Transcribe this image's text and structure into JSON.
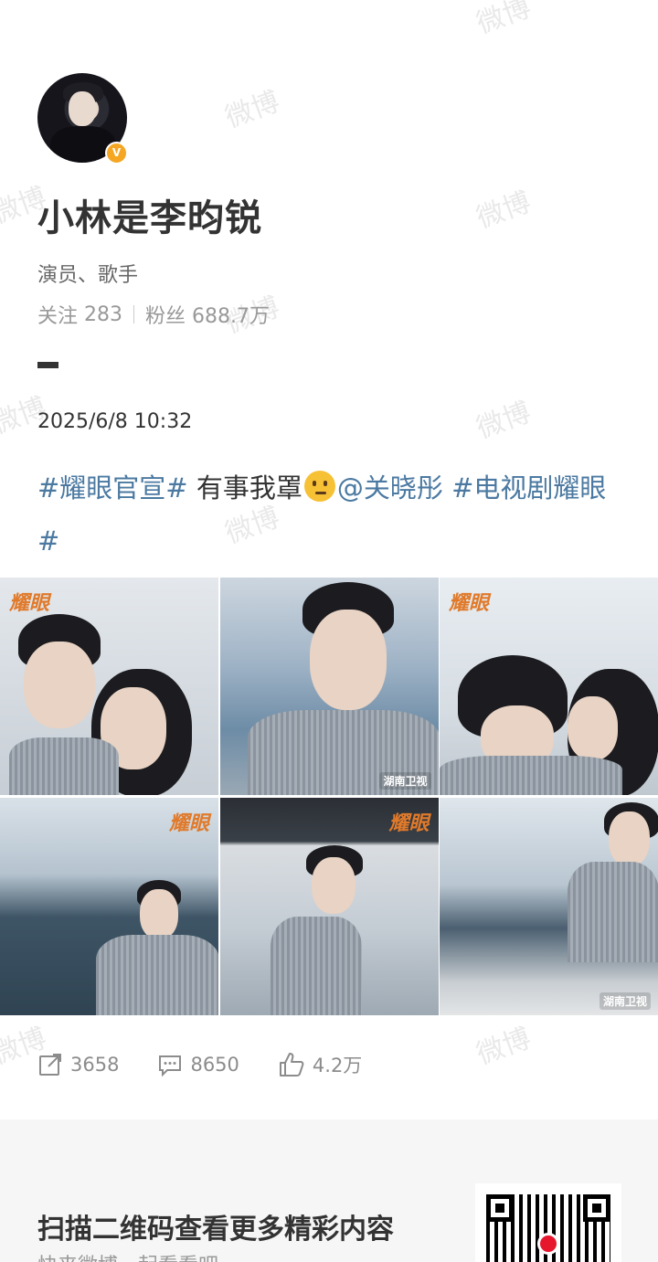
{
  "watermark_text": "微博",
  "profile": {
    "name": "小林是李昀锐",
    "verified_badge": "V",
    "bio": "演员、歌手",
    "following_label": "关注",
    "following_count": "283",
    "followers_label": "粉丝",
    "followers_count": "688.7万"
  },
  "post": {
    "date": "2025/6/8 10:32",
    "content": {
      "tag1": "#耀眼官宣#",
      "text": " 有事我罩",
      "emoji": "thinking-face-emoji",
      "mention": "@关晓彤",
      "tag2": "#电视剧耀眼#"
    },
    "images": [
      {
        "label": "image-1"
      },
      {
        "label": "image-2"
      },
      {
        "label": "image-3"
      },
      {
        "label": "image-4"
      },
      {
        "label": "image-5"
      },
      {
        "label": "image-6"
      }
    ],
    "image_logo": "耀眼",
    "image_watermark": "湖南卫视",
    "actions": {
      "repost_count": "3658",
      "comment_count": "8650",
      "like_count": "4.2万"
    }
  },
  "footer": {
    "title": "扫描二维码查看更多精彩内容",
    "subtitle": "快来微博一起看看吧"
  },
  "colors": {
    "link": "#4b79a1",
    "text": "#333333",
    "muted": "#999999",
    "verified": "#f5a623"
  }
}
